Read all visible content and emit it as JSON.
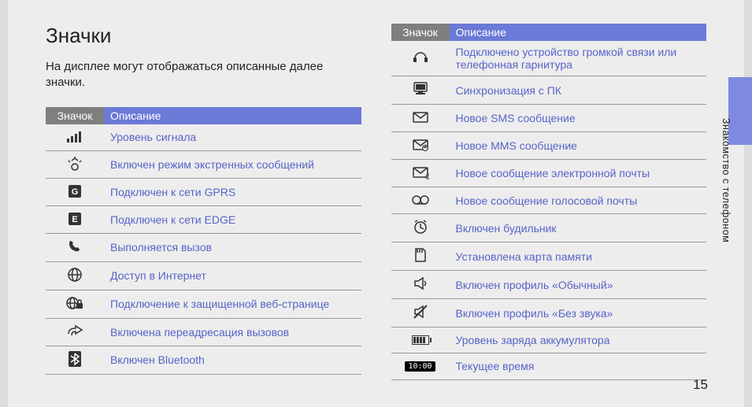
{
  "title": "Значки",
  "intro": "На дисплее могут отображаться описанные далее значки.",
  "headers": {
    "icon": "Значок",
    "desc": "Описание"
  },
  "table1": [
    {
      "icon": "signal-icon",
      "desc": "Уровень сигнала"
    },
    {
      "icon": "sos-icon",
      "desc": "Включен режим экстренных сообщений"
    },
    {
      "icon": "gprs-icon",
      "desc": "Подключен к сети GPRS"
    },
    {
      "icon": "edge-icon",
      "desc": "Подключен к сети EDGE"
    },
    {
      "icon": "call-icon",
      "desc": "Выполняется вызов"
    },
    {
      "icon": "globe-icon",
      "desc": "Доступ в Интернет"
    },
    {
      "icon": "secure-web-icon",
      "desc": "Подключение к защищенной веб-странице"
    },
    {
      "icon": "forward-icon",
      "desc": "Включена переадресация вызовов"
    },
    {
      "icon": "bluetooth-icon",
      "desc": "Включен Bluetooth"
    }
  ],
  "table2": [
    {
      "icon": "headset-icon",
      "desc": "Подключено устройство громкой связи или телефонная гарнитура"
    },
    {
      "icon": "pc-sync-icon",
      "desc": "Синхронизация с ПК"
    },
    {
      "icon": "sms-icon",
      "desc": "Новое SMS сообщение"
    },
    {
      "icon": "mms-icon",
      "desc": "Новое MMS сообщение"
    },
    {
      "icon": "email-icon",
      "desc": "Новое сообщение электронной почты"
    },
    {
      "icon": "voicemail-icon",
      "desc": "Новое сообщение голосовой почты"
    },
    {
      "icon": "alarm-icon",
      "desc": "Включен будильник"
    },
    {
      "icon": "sdcard-icon",
      "desc": "Установлена карта памяти"
    },
    {
      "icon": "normal-icon",
      "desc": "Включен профиль «Обычный»"
    },
    {
      "icon": "silent-icon",
      "desc": "Включен профиль «Без звука»"
    },
    {
      "icon": "battery-icon",
      "desc": "Уровень заряда аккумулятора"
    },
    {
      "icon": "time-icon",
      "desc": "Текущее время",
      "badge": "10:00"
    }
  ],
  "side_label": "Знакомство с телефоном",
  "page_number": "15"
}
